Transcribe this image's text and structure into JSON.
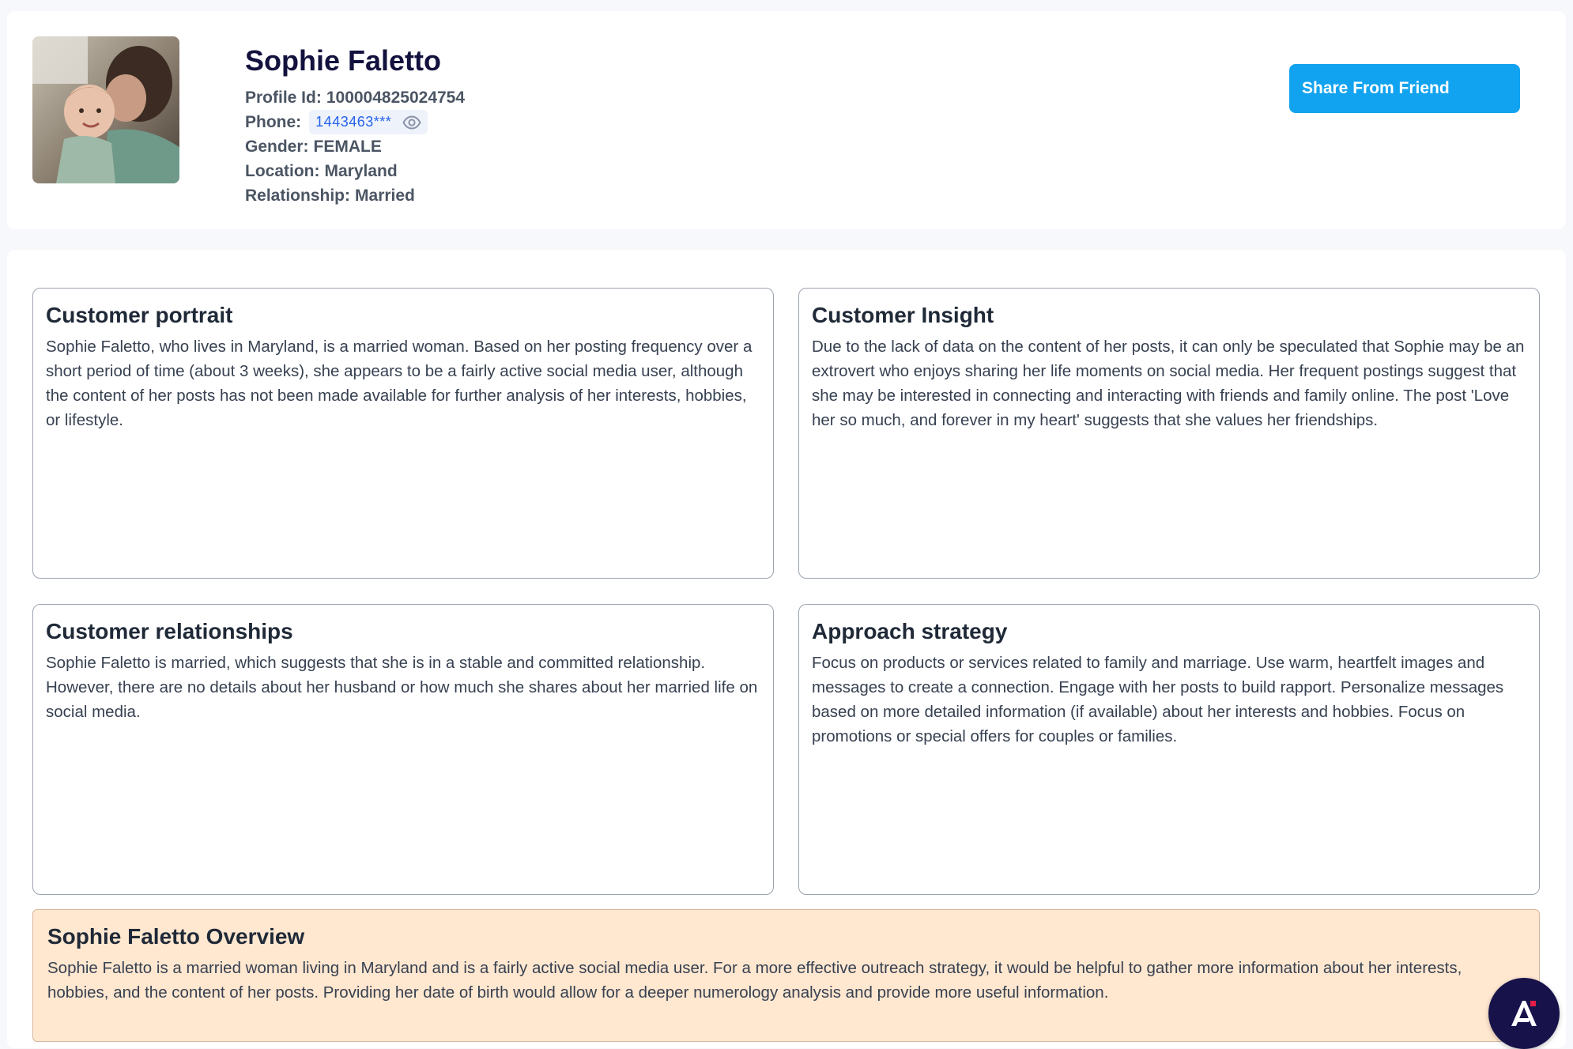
{
  "profile": {
    "name": "Sophie Faletto",
    "profile_id_label": "Profile Id:",
    "profile_id": "100004825024754",
    "phone_label": "Phone:",
    "phone": "1443463***",
    "gender_label": "Gender:",
    "gender": "FEMALE",
    "location_label": "Location:",
    "location": "Maryland",
    "relationship_label": "Relationship:",
    "relationship": "Married",
    "avatar_icon": "profile-photo"
  },
  "actions": {
    "share_label": "Share From Friend"
  },
  "panels": [
    {
      "title": "Customer portrait",
      "body": "Sophie Faletto, who lives in Maryland, is a married woman. Based on her posting frequency over a short period of time (about 3 weeks), she appears to be a fairly active social media user, although the content of her posts has not been made available for further analysis of her interests, hobbies, or lifestyle."
    },
    {
      "title": "Customer Insight",
      "body": "Due to the lack of data on the content of her posts, it can only be speculated that Sophie may be an extrovert who enjoys sharing her life moments on social media. Her frequent postings suggest that she may be interested in connecting and interacting with friends and family online. The post 'Love her so much, and forever in my heart' suggests that she values her friendships."
    },
    {
      "title": "Customer relationships",
      "body": "Sophie Faletto is married, which suggests that she is in a stable and committed relationship. However, there are no details about her husband or how much she shares about her married life on social media."
    },
    {
      "title": "Approach strategy",
      "body": "Focus on products or services related to family and marriage. Use warm, heartfelt images and messages to create a connection. Engage with her posts to build rapport. Personalize messages based on more detailed information (if available) about her interests and hobbies. Focus on promotions or special offers for couples or families."
    }
  ],
  "overview": {
    "title": "Sophie Faletto Overview",
    "body": "Sophie Faletto is a married woman living in Maryland and is a fairly active social media user. For a more effective outreach strategy, it would be helpful to gather more information about her interests, hobbies, and the content of her posts. Providing her date of birth would allow for a deeper numerology analysis and provide more useful information."
  },
  "colors": {
    "accent": "#12a3f0",
    "name": "#13113d",
    "overview_bg": "#ffe7d0",
    "fab_bg": "#17134a"
  },
  "icons": {
    "eye": "eye-icon",
    "fab": "app-logo-icon"
  }
}
